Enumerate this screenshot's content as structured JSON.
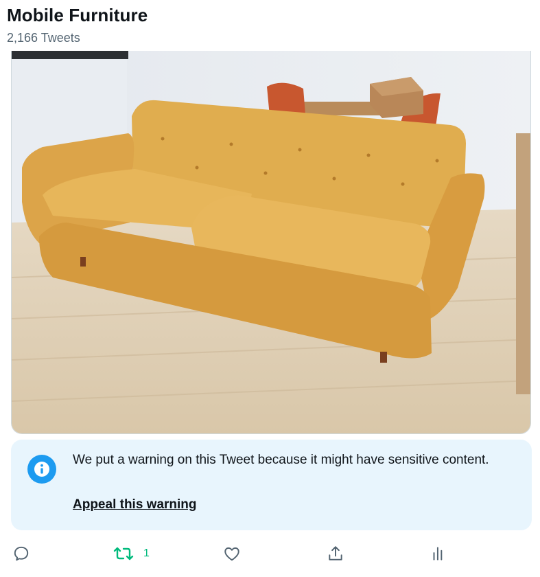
{
  "header": {
    "title": "Mobile Furniture",
    "tweet_count": "2,166 Tweets"
  },
  "tweet": {
    "media_alt": "Mustard yellow mid-century sofa on a light wood floor",
    "warning": {
      "text": "We put a warning on this Tweet because it might have sensitive content.",
      "appeal_label": "Appeal this warning"
    },
    "actions": {
      "reply_icon": "reply-icon",
      "retweet_icon": "retweet-icon",
      "retweet_count": "1",
      "like_icon": "like-icon",
      "share_icon": "share-icon",
      "analytics_icon": "analytics-icon"
    }
  },
  "colors": {
    "info_blue": "#1d9bf0",
    "retweet_green": "#00ba7c",
    "warning_bg": "#e8f5fd",
    "icon_gray": "#536471"
  }
}
